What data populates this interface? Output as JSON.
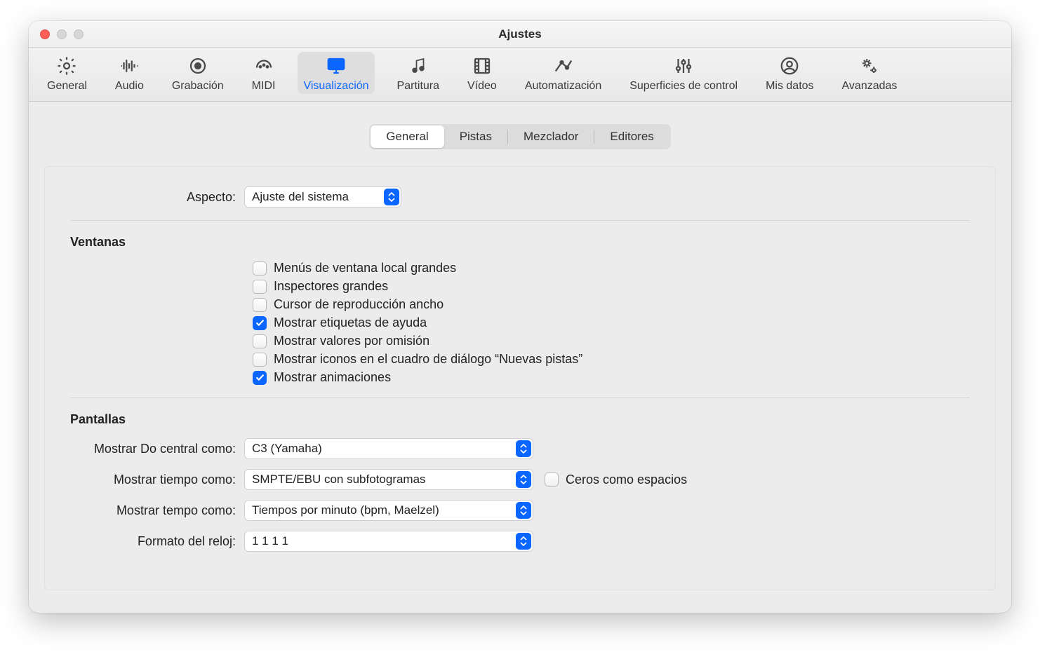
{
  "window": {
    "title": "Ajustes"
  },
  "toolbar": {
    "items": [
      {
        "id": "general",
        "label": "General"
      },
      {
        "id": "audio",
        "label": "Audio"
      },
      {
        "id": "recording",
        "label": "Grabación"
      },
      {
        "id": "midi",
        "label": "MIDI"
      },
      {
        "id": "display",
        "label": "Visualización"
      },
      {
        "id": "score",
        "label": "Partitura"
      },
      {
        "id": "video",
        "label": "Vídeo"
      },
      {
        "id": "automation",
        "label": "Automatización"
      },
      {
        "id": "surfaces",
        "label": "Superficies de control"
      },
      {
        "id": "mydata",
        "label": "Mis datos"
      },
      {
        "id": "advanced",
        "label": "Avanzadas"
      }
    ]
  },
  "tabs": {
    "items": [
      "General",
      "Pistas",
      "Mezclador",
      "Editores"
    ],
    "active": 0
  },
  "appearance": {
    "label": "Aspecto:",
    "value": "Ajuste del sistema"
  },
  "windows": {
    "heading": "Ventanas",
    "checks": [
      {
        "label": "Menús de ventana local grandes",
        "checked": false
      },
      {
        "label": "Inspectores grandes",
        "checked": false
      },
      {
        "label": "Cursor de reproducción ancho",
        "checked": false
      },
      {
        "label": "Mostrar etiquetas de ayuda",
        "checked": true
      },
      {
        "label": "Mostrar valores por omisión",
        "checked": false
      },
      {
        "label": "Mostrar iconos en el cuadro de diálogo “Nuevas pistas”",
        "checked": false
      },
      {
        "label": "Mostrar animaciones",
        "checked": true
      }
    ]
  },
  "displays": {
    "heading": "Pantallas",
    "rows": [
      {
        "label": "Mostrar Do central como:",
        "value": "C3 (Yamaha)"
      },
      {
        "label": "Mostrar tiempo como:",
        "value": "SMPTE/EBU con subfotogramas",
        "extra_checkbox": {
          "label": "Ceros como espacios",
          "checked": false
        }
      },
      {
        "label": "Mostrar tempo como:",
        "value": "Tiempos por minuto (bpm, Maelzel)"
      },
      {
        "label": "Formato del reloj:",
        "value": "1 1 1 1"
      }
    ]
  }
}
